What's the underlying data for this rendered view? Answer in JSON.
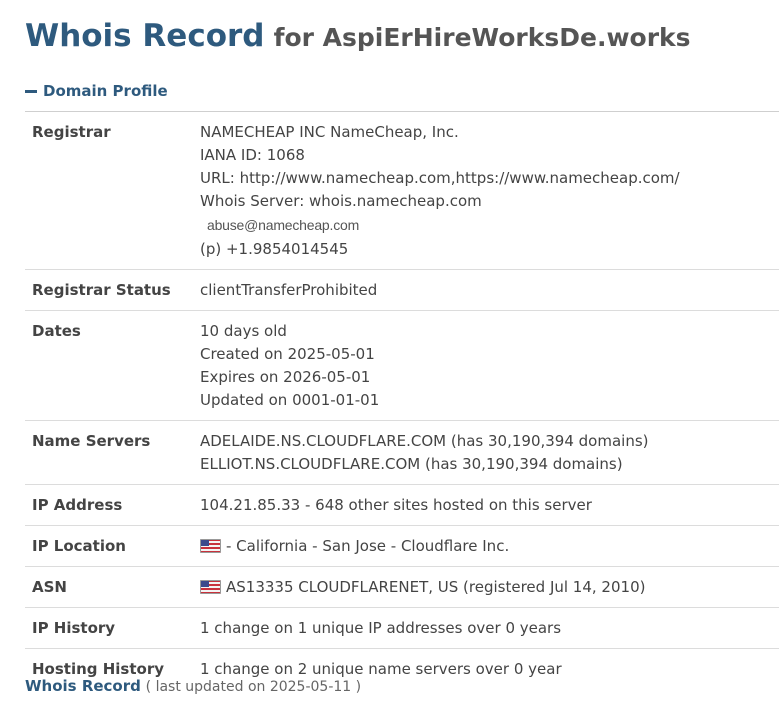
{
  "header": {
    "title_main": "Whois Record",
    "title_for": "for AspiErHireWorksDe.works"
  },
  "section": {
    "label": "Domain Profile",
    "toggle_icon": "minus-icon"
  },
  "rows": {
    "registrar": {
      "key": "Registrar",
      "lines": [
        "NAMECHEAP INC NameCheap, Inc.",
        "IANA ID: 1068",
        "URL: http://www.namecheap.com,https://www.namecheap.com/",
        "Whois Server: whois.namecheap.com"
      ],
      "email": "abuse@namecheap.com",
      "phone": "(p) +1.9854014545"
    },
    "status": {
      "key": "Registrar Status",
      "value": "clientTransferProhibited"
    },
    "dates": {
      "key": "Dates",
      "lines": [
        "10 days old",
        "Created on 2025-05-01",
        "Expires on 2026-05-01",
        "Updated on 0001-01-01"
      ]
    },
    "name_servers": {
      "key": "Name Servers",
      "lines": [
        "ADELAIDE.NS.CLOUDFLARE.COM (has 30,190,394 domains)",
        "ELLIOT.NS.CLOUDFLARE.COM (has 30,190,394 domains)"
      ]
    },
    "ip_address": {
      "key": "IP Address",
      "value": "104.21.85.33 - 648 other sites hosted on this server"
    },
    "ip_location": {
      "key": "IP Location",
      "flag": "us-flag-icon",
      "value": "- California - San Jose - Cloudflare Inc."
    },
    "asn": {
      "key": "ASN",
      "flag": "us-flag-icon",
      "value": "AS13335 CLOUDFLARENET, US (registered Jul 14, 2010)"
    },
    "ip_history": {
      "key": "IP History",
      "value": "1 change on 1 unique IP addresses over 0 years"
    },
    "hosting_history": {
      "key": "Hosting History",
      "value": "1 change on 2 unique name servers over 0 year"
    }
  },
  "footer": {
    "link": "Whois Record",
    "updated": "( last updated on 2025-05-11 )"
  },
  "colors": {
    "accent": "#2e5a7e",
    "text": "#444444",
    "divider": "#dcdcdc"
  }
}
